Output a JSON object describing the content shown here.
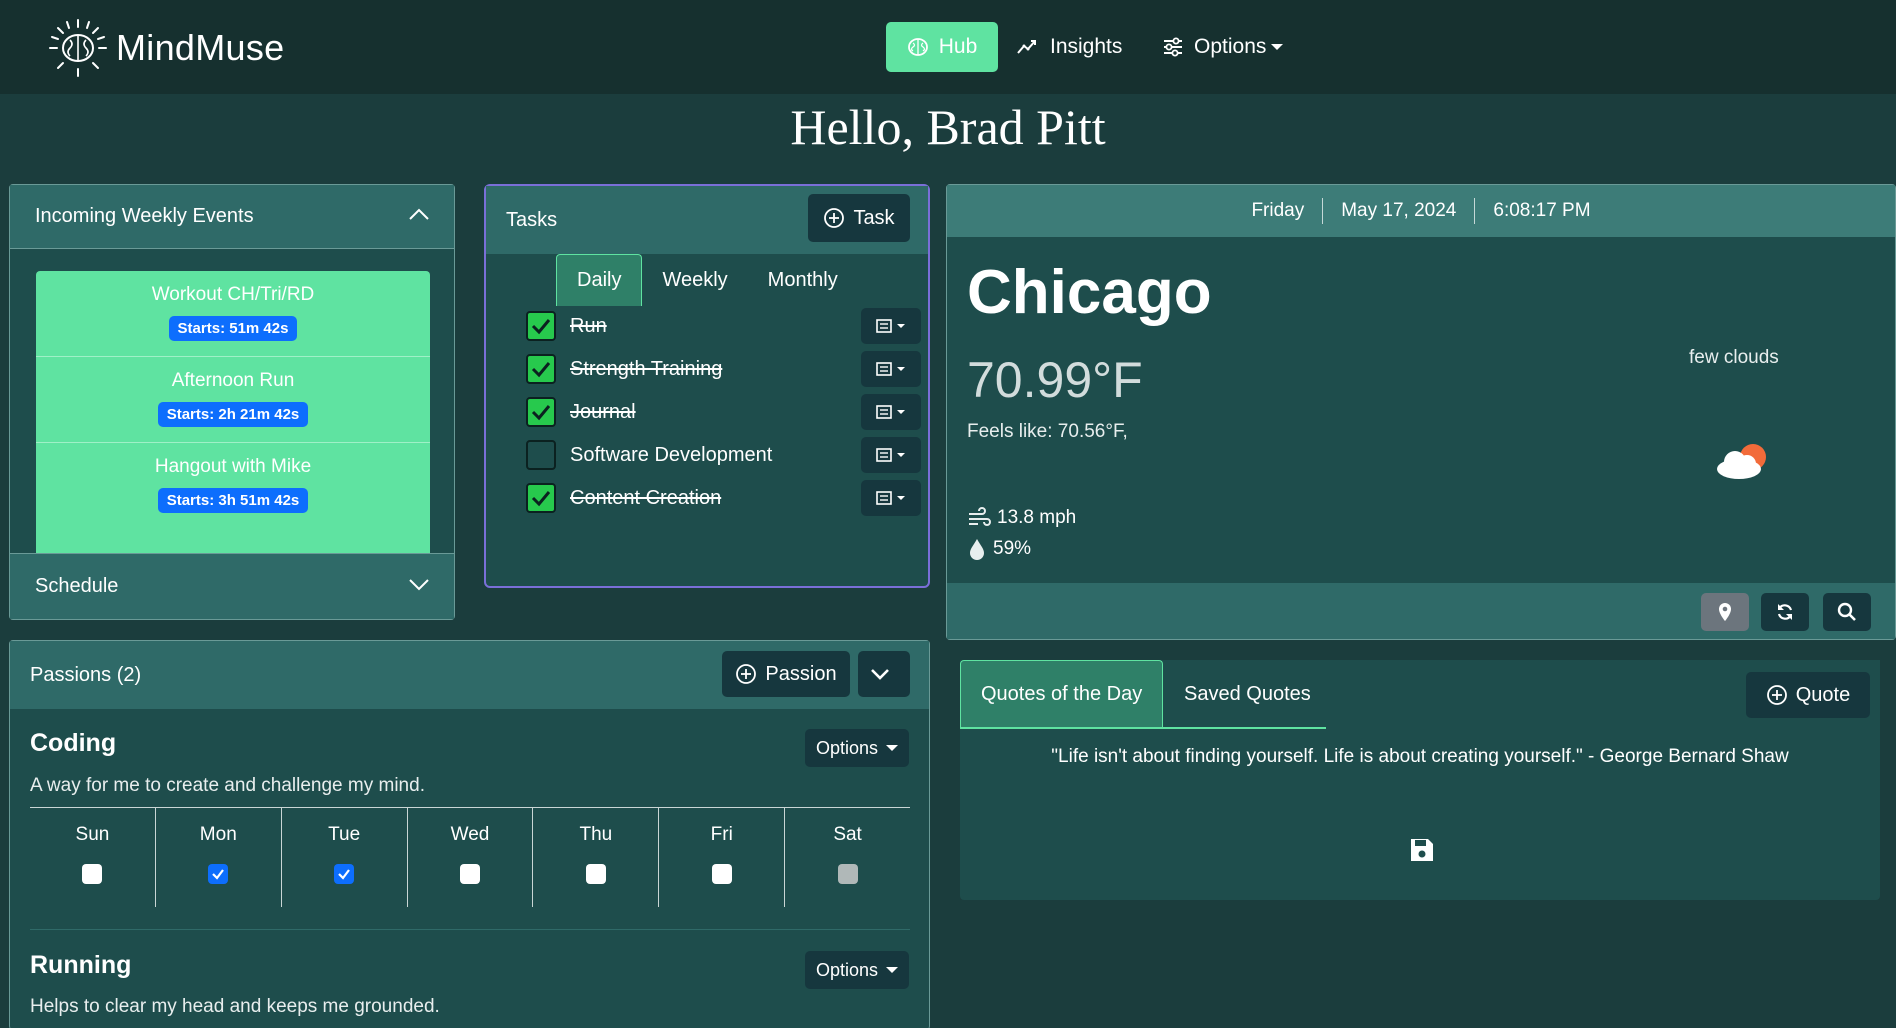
{
  "nav": {
    "brand": "MindMuse",
    "hub": "Hub",
    "insights": "Insights",
    "options": "Options"
  },
  "greeting": "Hello, Brad Pitt",
  "events": {
    "header": "Incoming Weekly Events",
    "items": [
      {
        "title": "Workout CH/Tri/RD",
        "badge": "Starts: 51m 42s"
      },
      {
        "title": "Afternoon Run",
        "badge": "Starts: 2h 21m 42s"
      },
      {
        "title": "Hangout with Mike",
        "badge": "Starts: 3h 51m 42s"
      }
    ],
    "schedule": "Schedule"
  },
  "tasks": {
    "header": "Tasks",
    "add_label": "Task",
    "tabs": [
      "Daily",
      "Weekly",
      "Monthly"
    ],
    "active_tab": "Daily",
    "items": [
      {
        "label": "Run",
        "done": true
      },
      {
        "label": "Strength Training",
        "done": true
      },
      {
        "label": "Journal",
        "done": true
      },
      {
        "label": "Software Development",
        "done": false
      },
      {
        "label": "Content Creation",
        "done": true
      }
    ]
  },
  "weather": {
    "day": "Friday",
    "date": "May 17, 2024",
    "time": "6:08:17 PM",
    "city": "Chicago",
    "temp": "70.99°F",
    "feels": "Feels like: 70.56°F,",
    "desc": "few clouds",
    "wind": "13.8 mph",
    "humidity": "59%",
    "icon": "cloud-sun-icon"
  },
  "passions": {
    "header": "Passions (2)",
    "add_label": "Passion",
    "options_label": "Options",
    "days": [
      "Sun",
      "Mon",
      "Tue",
      "Wed",
      "Thu",
      "Fri",
      "Sat"
    ],
    "items": [
      {
        "title": "Coding",
        "desc": "A way for me to create and challenge my mind.",
        "checked": [
          false,
          true,
          true,
          false,
          false,
          false,
          false
        ]
      },
      {
        "title": "Running",
        "desc": "Helps to clear my head and keeps me grounded."
      }
    ]
  },
  "quotes": {
    "tab_day": "Quotes of the Day",
    "tab_saved": "Saved Quotes",
    "add_label": "Quote",
    "text": "\"Life isn't about finding yourself. Life is about creating yourself.\" - George Bernard Shaw"
  },
  "colors": {
    "accent": "#5fe3a1",
    "background": "#1b3d3d",
    "panel": "#1e4d4c",
    "badge": "#0d6efd"
  }
}
